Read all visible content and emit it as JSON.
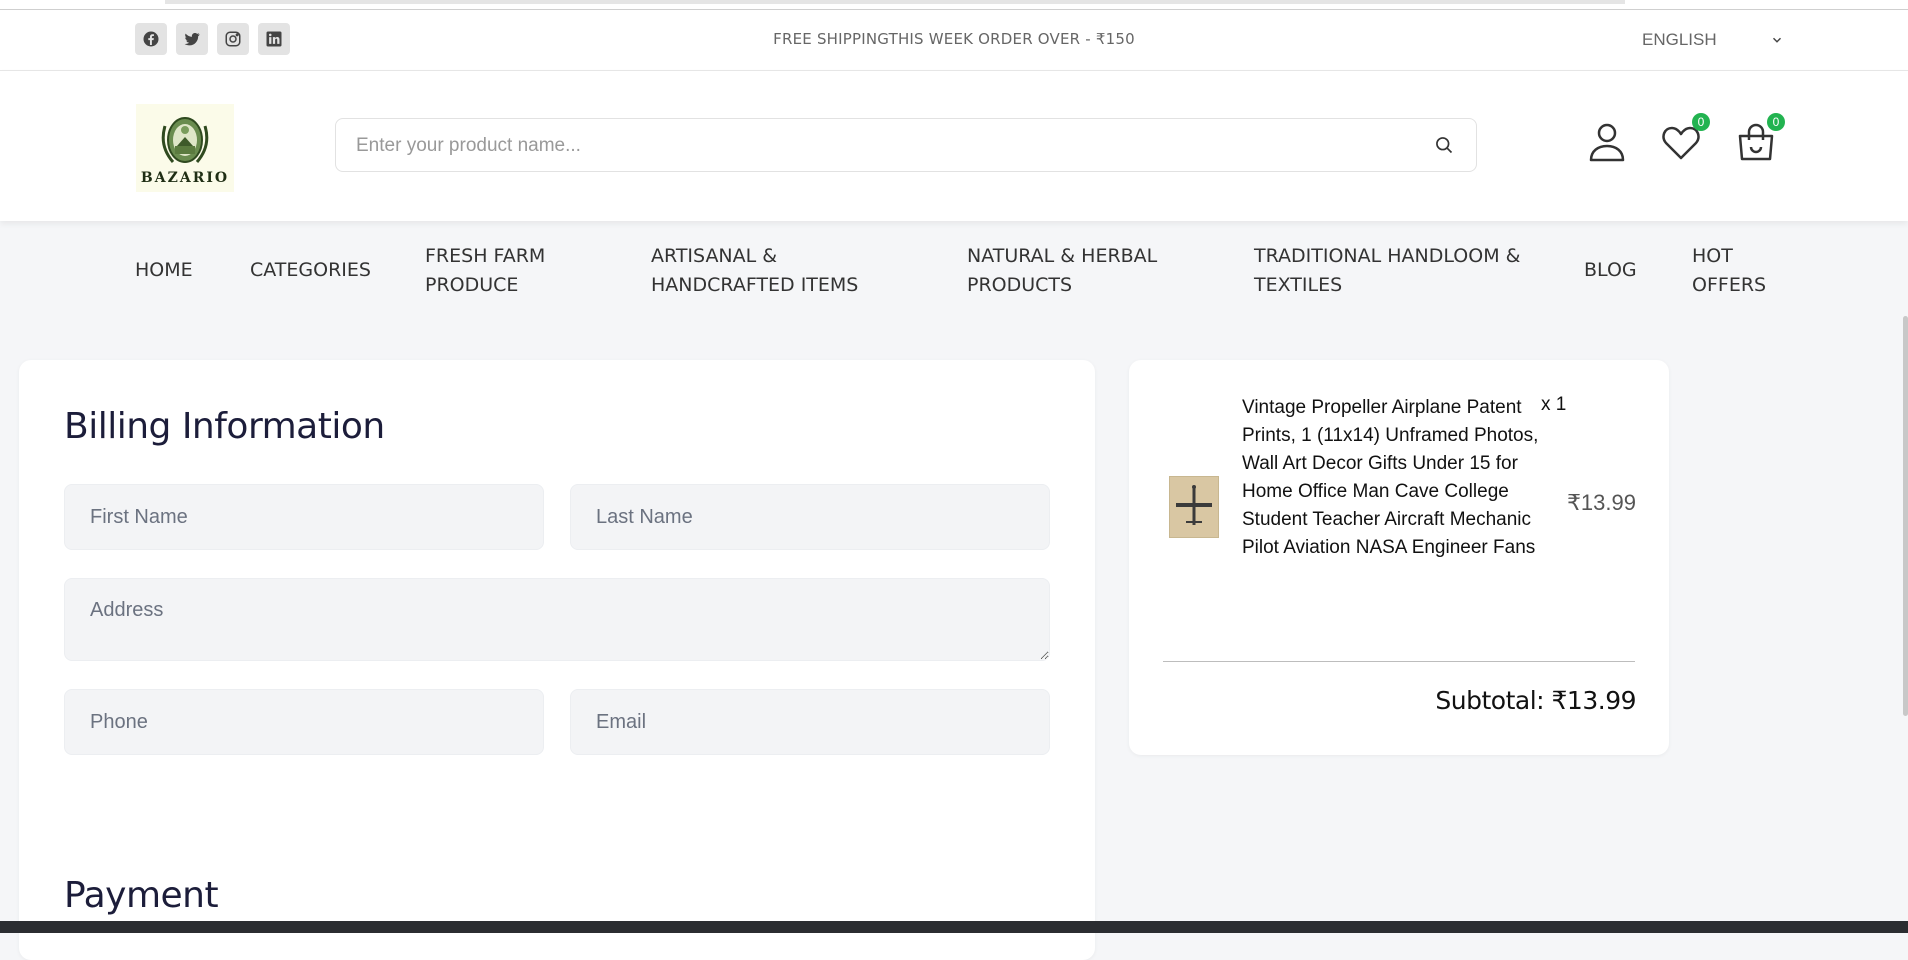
{
  "topbar": {
    "socials": [
      "facebook-icon",
      "twitter-icon",
      "instagram-icon",
      "linkedin-icon"
    ],
    "promo": "FREE SHIPPINGTHIS WEEK ORDER OVER - ₹150",
    "language": "ENGLISH"
  },
  "header": {
    "logo_text": "BAZARIO",
    "search_placeholder": "Enter your product name...",
    "wishlist_count": "0",
    "cart_count": "0"
  },
  "nav": [
    {
      "label": "HOME"
    },
    {
      "label": "CATEGORIES"
    },
    {
      "label": "FRESH FARM PRODUCE"
    },
    {
      "label": "ARTISANAL & HANDCRAFTED ITEMS"
    },
    {
      "label": "NATURAL & HERBAL PRODUCTS"
    },
    {
      "label": "TRADITIONAL HANDLOOM & TEXTILES"
    },
    {
      "label": "BLOG"
    },
    {
      "label": "HOT OFFERS"
    }
  ],
  "billing": {
    "title": "Billing Information",
    "first_name_placeholder": "First Name",
    "last_name_placeholder": "Last Name",
    "address_placeholder": "Address",
    "phone_placeholder": "Phone",
    "email_placeholder": "Email",
    "payment_title": "Payment"
  },
  "summary": {
    "item_title": "Vintage Propeller Airplane Patent Prints, 1 (11x14) Unframed Photos, Wall Art Decor Gifts Under 15 for Home Office Man Cave College Student Teacher Aircraft Mechanic Pilot Aviation NASA Engineer Fans",
    "quantity": "x  1",
    "price": "₹13.99",
    "subtotal": "Subtotal: ₹13.99"
  },
  "colors": {
    "badge": "#22b350",
    "title": "#1c1d3a",
    "field_bg": "#f3f4f6"
  }
}
